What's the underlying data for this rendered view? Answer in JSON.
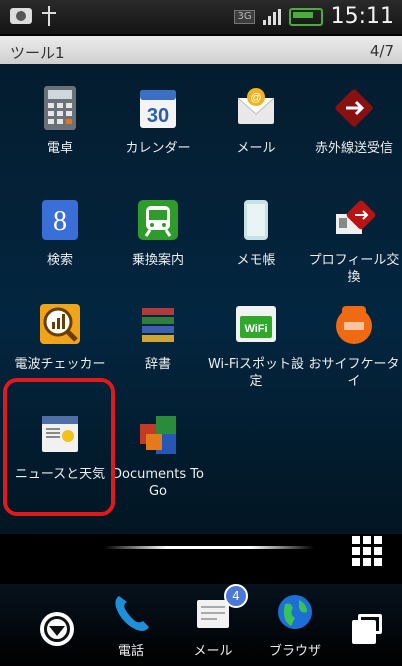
{
  "status_bar": {
    "network": "3G",
    "time": "15:11"
  },
  "page_header": {
    "title": "ツール1",
    "page_indicator": "4/7"
  },
  "apps": [
    {
      "label": "電卓",
      "icon": "calculator-icon"
    },
    {
      "label": "カレンダー",
      "icon": "calendar-icon",
      "day": "30"
    },
    {
      "label": "メール",
      "icon": "mail-icon"
    },
    {
      "label": "赤外線送受信",
      "icon": "infrared-icon"
    },
    {
      "label": "検索",
      "icon": "search-icon"
    },
    {
      "label": "乗換案内",
      "icon": "train-icon"
    },
    {
      "label": "メモ帳",
      "icon": "memo-icon"
    },
    {
      "label": "プロフィール交換",
      "icon": "profile-exchange-icon"
    },
    {
      "label": "電波チェッカー",
      "icon": "signal-checker-icon"
    },
    {
      "label": "辞書",
      "icon": "dictionary-icon"
    },
    {
      "label": "Wi-Fiスポット設定",
      "icon": "wifi-icon",
      "icon_text": "WiFi"
    },
    {
      "label": "おサイフケータイ",
      "icon": "osaifu-icon"
    },
    {
      "label": "ニュースと天気",
      "icon": "news-weather-icon"
    },
    {
      "label": "Documents To Go",
      "icon": "documents-icon"
    }
  ],
  "dock": {
    "items": [
      {
        "label": "電話",
        "icon": "phone-icon"
      },
      {
        "label": "メール",
        "icon": "mail-icon",
        "badge": "4"
      },
      {
        "label": "ブラウザ",
        "icon": "browser-icon"
      }
    ]
  },
  "colors": {
    "selection_highlight": "#e01a1a",
    "page_bar": "#dcdcdc",
    "background": "#032640"
  }
}
